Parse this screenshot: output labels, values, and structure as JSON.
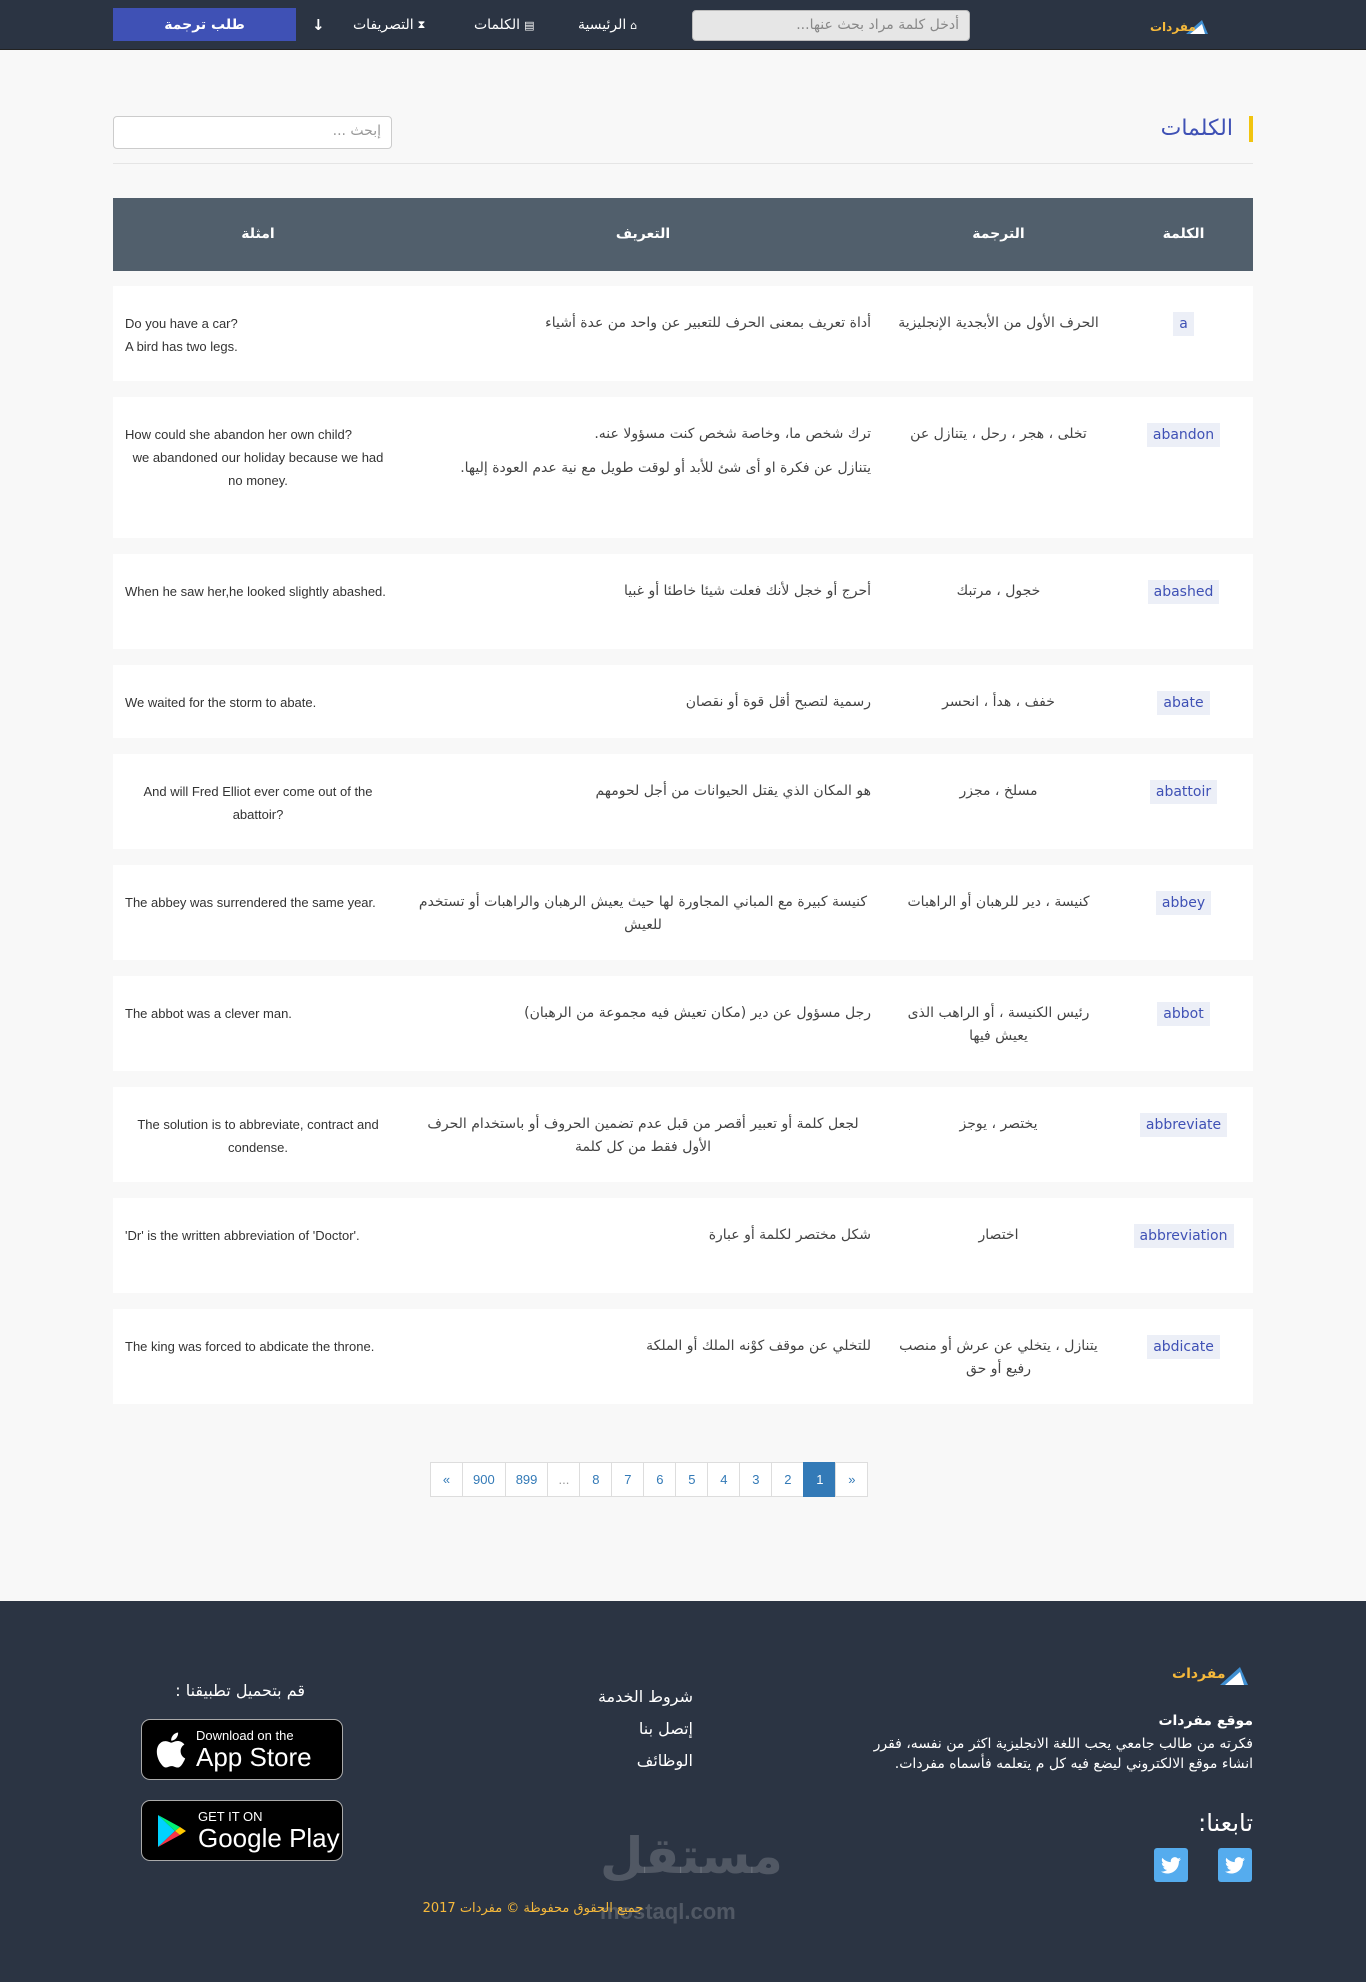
{
  "header": {
    "logo_text": "مفردات",
    "search_placeholder": "أدخل كلمة مراد بحث عنها...",
    "nav": [
      {
        "label": "الرئيسية",
        "icon": "home-icon",
        "glyph": "⌂"
      },
      {
        "label": "الكلمات",
        "icon": "book-icon",
        "glyph": "▤"
      },
      {
        "label": "التصريفات",
        "icon": "hourglass-icon",
        "glyph": "⧗"
      },
      {
        "label": "",
        "icon": "arrow-down-icon",
        "glyph": "↓"
      }
    ],
    "request_button": "طلب ترجمة"
  },
  "page": {
    "title": "الكلمات",
    "search_placeholder": "إبحث ..."
  },
  "table": {
    "columns": [
      "الكلمة",
      "الترجمة",
      "التعريف",
      "امثلة"
    ],
    "rows": [
      {
        "word": "a",
        "translation": "الحرف الأول من الأبجدية الإنجليزية",
        "definition": [
          "أداة تعريف بمعنى الحرف للتعبير عن واحد من عدة أشياء"
        ],
        "examples": [
          "Do you have a car?",
          "A bird has two legs."
        ]
      },
      {
        "word": "abandon",
        "translation": "تخلى ، هجر ، رحل ، يتنازل عن",
        "definition": [
          "ترك شخص ما، وخاصة شخص كنت مسؤولا عنه.",
          "يتنازل عن فكرة او أى شئ للأبد أو لوقت طويل مع نية عدم العودة إليها."
        ],
        "examples": [
          "How could she abandon her own child?",
          "we abandoned our holiday because we had no money."
        ]
      },
      {
        "word": "abashed",
        "translation": "خجول ، مرتبك",
        "definition": [
          "أحرج أو خجل لأنك فعلت شيئا خاطئا أو غبيا"
        ],
        "examples": [
          "When he saw her,he looked slightly abashed."
        ]
      },
      {
        "word": "abate",
        "translation": "خفف ، هدأ ، انحسر",
        "definition": [
          "رسمية لتصبح أقل قوة أو نقصان"
        ],
        "examples": [
          "We waited for the storm to abate."
        ]
      },
      {
        "word": "abattoir",
        "translation": "مسلخ ، مجزر",
        "definition": [
          "هو المكان الذي يقتل الحيوانات من أجل لحومهم"
        ],
        "examples": [
          "And will Fred Elliot ever come out of the abattoir?"
        ]
      },
      {
        "word": "abbey",
        "translation": "كنيسة ، دير للرهبان أو الراهبات",
        "definition": [
          "كنيسة كبيرة مع المباني المجاورة لها حيث يعيش الرهبان والراهبات أو تستخدم للعيش"
        ],
        "examples": [
          "The abbey was surrendered the same year."
        ]
      },
      {
        "word": "abbot",
        "translation": "رئيس الكنيسة ، أو الراهب الذى يعيش فيها",
        "definition": [
          "رجل مسؤول عن دير (مكان تعيش فيه مجموعة من الرهبان)"
        ],
        "examples": [
          "The abbot was a clever man."
        ]
      },
      {
        "word": "abbreviate",
        "translation": "يختصر ، يوجز",
        "definition": [
          "لجعل كلمة أو تعبير أقصر من قبل عدم تضمين الحروف أو باستخدام الحرف الأول فقط من كل كلمة"
        ],
        "examples": [
          "The solution is to abbreviate, contract and condense."
        ]
      },
      {
        "word": "abbreviation",
        "translation": "اختصار",
        "definition": [
          "شكل مختصر لكلمة أو عبارة"
        ],
        "examples": [
          "'Dr' is the written abbreviation of 'Doctor'."
        ]
      },
      {
        "word": "abdicate",
        "translation": "يتنازل ، يتخلي عن عرش أو منصب رفيع أو حق",
        "definition": [
          "للتخلي عن موقف كوْنه الملك أو الملكة"
        ],
        "examples": [
          "The king was forced to abdicate the throne."
        ]
      }
    ]
  },
  "pagination": [
    "«",
    "900",
    "899",
    "...",
    "8",
    "7",
    "6",
    "5",
    "4",
    "3",
    "2",
    "1",
    "»"
  ],
  "pagination_active": "1",
  "footer": {
    "logo_text": "مفردات",
    "about_title": "موقع مفردات",
    "about_text": "فكرته من طالب جامعي يحب اللغة الانجليزية اكثر من نفسه، فقرر انشاء موقع الالكتروني ليضع فيه كل م يتعلمه فأسماه مفردات.",
    "follow_label": "تابعنا:",
    "links": [
      "شروط الخدمة",
      "إتصل بنا",
      "الوظائف"
    ],
    "download_title": "قم بتحميل تطبيقنا :",
    "app_store": {
      "small": "Download on the",
      "big": "App Store"
    },
    "google_play": {
      "small": "GET IT ON",
      "big": "Google Play"
    },
    "copyright": "جميع الحقوق محفوظة © مفردات 2017",
    "watermark": "مستقل",
    "watermark_sub": "mostaql.com"
  },
  "colors": {
    "navbar": "#2b3443",
    "accent": "#3f51b5",
    "table_header": "#515f6c",
    "brand_yellow": "#f6b93b",
    "twitter": "#55acee",
    "pager_active": "#337ab7"
  }
}
